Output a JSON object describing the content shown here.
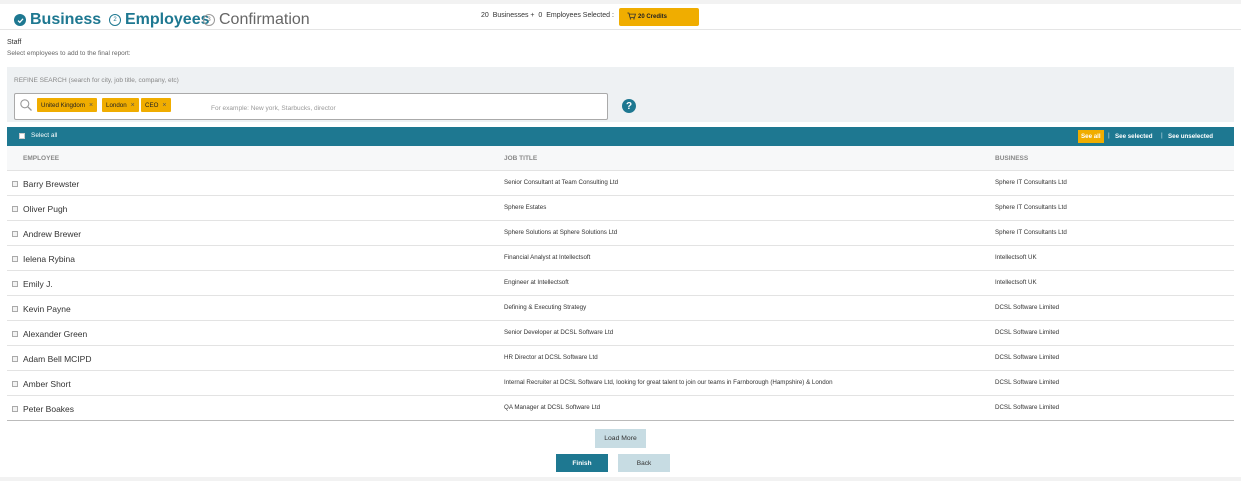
{
  "stepper": {
    "steps": [
      {
        "number": "",
        "label": "Business",
        "state": "done"
      },
      {
        "number": "2",
        "label": "Employees",
        "state": "active"
      },
      {
        "number": "3",
        "label": "Confirmation",
        "state": "pending"
      }
    ]
  },
  "summary": {
    "businesses_count": "20",
    "businesses_label": "Businesses +",
    "employees_count": "0",
    "employees_label": "Employees Selected :",
    "credits_label": "20 Credits"
  },
  "staff": {
    "title": "Staff",
    "subtitle": "Select employees to add to the final report:"
  },
  "refine": {
    "label": "REFINE SEARCH (search for city, job title, company, etc)",
    "tags": [
      "United Kingdom",
      "London",
      "CEO"
    ],
    "placeholder": "For example: New york, Starbucks, director"
  },
  "table_bar": {
    "select_all": "Select all",
    "filters": [
      "See all",
      "See selected",
      "See unselected"
    ],
    "active_filter": "See all"
  },
  "columns": [
    "EMPLOYEE",
    "JOB TITLE",
    "BUSINESS"
  ],
  "rows": [
    {
      "name": "Barry Brewster",
      "job": "Senior Consultant at Team Consulting Ltd",
      "business": "Sphere IT Consultants Ltd"
    },
    {
      "name": "Oliver Pugh",
      "job": "Sphere Estates",
      "business": "Sphere IT Consultants Ltd"
    },
    {
      "name": "Andrew Brewer",
      "job": "Sphere Solutions at Sphere Solutions Ltd",
      "business": "Sphere IT Consultants Ltd"
    },
    {
      "name": "Ielena Rybina",
      "job": "Financial Analyst at Intellectsoft",
      "business": "Intellectsoft UK"
    },
    {
      "name": "Emily J.",
      "job": "Engineer at Intellectsoft",
      "business": "Intellectsoft UK"
    },
    {
      "name": "Kevin Payne",
      "job": "Defining & Executing Strategy",
      "business": "DCSL Software Limited"
    },
    {
      "name": "Alexander Green",
      "job": "Senior Developer at DCSL Software Ltd",
      "business": "DCSL Software Limited"
    },
    {
      "name": "Adam Bell MCIPD",
      "job": "HR Director at DCSL Software Ltd",
      "business": "DCSL Software Limited"
    },
    {
      "name": "Amber Short",
      "job": "Internal Recruiter at DCSL Software Ltd, looking for great talent to join our teams in Farnborough (Hampshire) & London",
      "business": "DCSL Software Limited"
    },
    {
      "name": "Peter Boakes",
      "job": "QA Manager at DCSL Software Ltd",
      "business": "DCSL Software Limited"
    }
  ],
  "buttons": {
    "load_more": "Load More",
    "finish": "Finish",
    "back": "Back"
  },
  "colors": {
    "primary": "#1e7891",
    "accent": "#f0ad00",
    "secondary_button": "#c7dce3"
  }
}
